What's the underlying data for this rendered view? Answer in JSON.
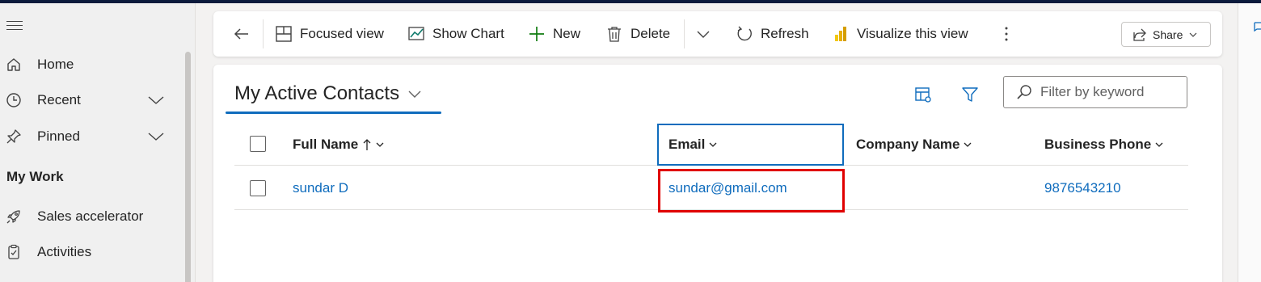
{
  "sidebar": {
    "items": [
      {
        "label": "Home",
        "icon": "home-icon"
      },
      {
        "label": "Recent",
        "icon": "clock-icon"
      },
      {
        "label": "Pinned",
        "icon": "pin-icon"
      }
    ],
    "section_title": "My Work",
    "work_items": [
      {
        "label": "Sales accelerator",
        "icon": "rocket-icon"
      },
      {
        "label": "Activities",
        "icon": "clipboard-icon"
      }
    ]
  },
  "commandbar": {
    "focused_view": "Focused view",
    "show_chart": "Show Chart",
    "new": "New",
    "delete": "Delete",
    "refresh": "Refresh",
    "visualize": "Visualize this view",
    "share": "Share"
  },
  "view": {
    "title": "My Active Contacts",
    "filter_placeholder": "Filter by keyword"
  },
  "grid": {
    "columns": [
      "Full Name",
      "Email",
      "Company Name",
      "Business Phone"
    ],
    "rows": [
      {
        "full_name": "sundar D",
        "email": "sundar@gmail.com",
        "company_name": "",
        "business_phone": "9876543210"
      }
    ]
  },
  "colors": {
    "accent": "#0f6cbd",
    "highlight": "#e00000",
    "topbar": "#0b1a3c"
  }
}
